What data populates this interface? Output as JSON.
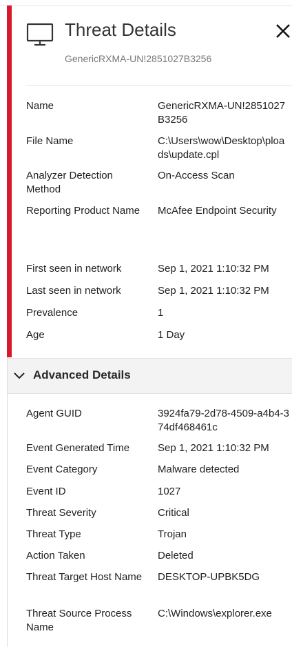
{
  "header": {
    "title": "Threat Details",
    "subtitle": "GenericRXMA-UN!2851027B3256",
    "icon": "monitor-icon",
    "close_icon": "close-icon"
  },
  "colors": {
    "severity_bar": "#d8182c"
  },
  "details": [
    {
      "label": "Name",
      "value": "GenericRXMA-UN!2851027B3256"
    },
    {
      "label": "File Name",
      "value": "C:\\Users\\wow\\Desktop\\ploads\\update.cpl"
    },
    {
      "label": "Analyzer Detection Method",
      "value": "On-Access Scan"
    },
    {
      "label": "Reporting Product Name",
      "value": "McAfee Endpoint Security"
    },
    {
      "label": "First seen in network",
      "value": "Sep 1, 2021 1:10:32 PM"
    },
    {
      "label": "Last seen in network",
      "value": "Sep 1, 2021 1:10:32 PM"
    },
    {
      "label": "Prevalence",
      "value": "1"
    },
    {
      "label": "Age",
      "value": "1 Day"
    }
  ],
  "advanced": {
    "title": "Advanced Details",
    "expanded": true,
    "rows": [
      {
        "label": "Agent GUID",
        "value": "3924fa79-2d78-4509-a4b4-374df468461c"
      },
      {
        "label": "Event Generated Time",
        "value": "Sep 1, 2021 1:10:32 PM"
      },
      {
        "label": "Event Category",
        "value": "Malware detected"
      },
      {
        "label": "Event ID",
        "value": "1027"
      },
      {
        "label": "Threat Severity",
        "value": "Critical"
      },
      {
        "label": "Threat Type",
        "value": "Trojan"
      },
      {
        "label": "Action Taken",
        "value": "Deleted"
      },
      {
        "label": "Threat Target Host Name",
        "value": "DESKTOP-UPBK5DG"
      },
      {
        "label": "Threat Source Process Name",
        "value": "C:\\Windows\\explorer.exe"
      }
    ]
  }
}
